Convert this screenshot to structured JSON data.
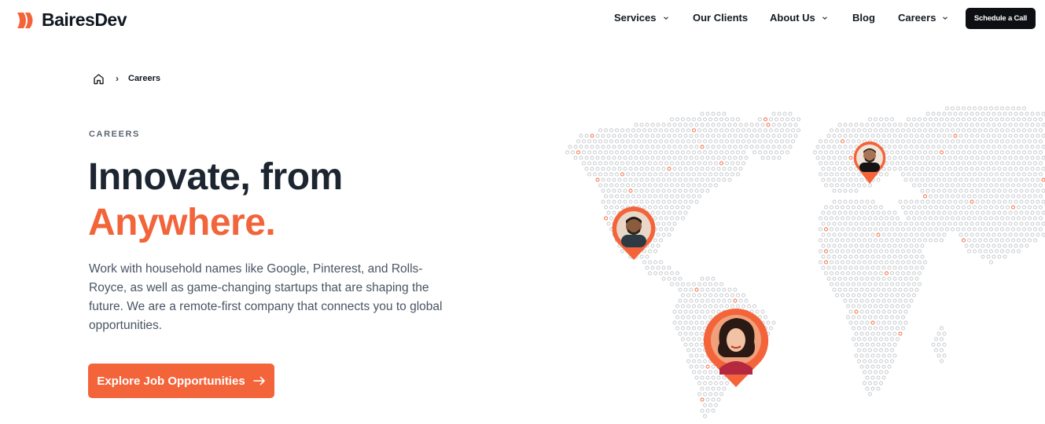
{
  "brand": {
    "name": "BairesDev",
    "accent_color": "#f4643a",
    "logo_icon": "bairesdev-logo-mark"
  },
  "nav": {
    "items": [
      {
        "label": "Services",
        "has_dropdown": true
      },
      {
        "label": "Our Clients",
        "has_dropdown": false
      },
      {
        "label": "About Us",
        "has_dropdown": true
      },
      {
        "label": "Blog",
        "has_dropdown": false
      },
      {
        "label": "Careers",
        "has_dropdown": true
      }
    ],
    "cta_label": "Schedule a Call"
  },
  "breadcrumb": {
    "home_icon": "home-icon",
    "separator": "›",
    "current": "Careers"
  },
  "hero": {
    "eyebrow": "CAREERS",
    "title_line1": "Innovate, from",
    "title_line2": "Anywhere.",
    "description": "Work with household names like Google, Pinterest, and Rolls-Royce, as well as game-changing startups that are shaping the future. We are a remote-first company that connects you to global opportunities.",
    "button_label": "Explore Job Opportunities",
    "button_icon": "arrow-right-icon"
  },
  "map": {
    "icon": "world-dot-map",
    "pins": [
      {
        "name": "person-pin-mexico",
        "location": "North America"
      },
      {
        "name": "person-pin-europe",
        "location": "Europe"
      },
      {
        "name": "person-pin-southamerica",
        "location": "South America"
      }
    ]
  }
}
